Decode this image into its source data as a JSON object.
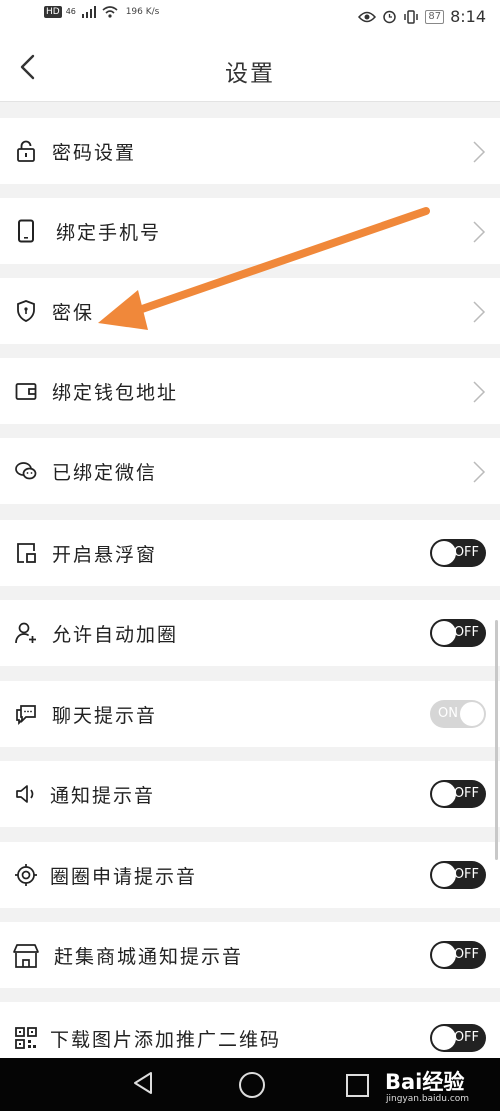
{
  "status_bar": {
    "hd": "HD",
    "network": "46",
    "speed": "196 K/s",
    "battery": "87",
    "time": "8:14"
  },
  "header": {
    "title": "设置"
  },
  "rows": [
    {
      "label": "密码设置",
      "icon": "lock-icon",
      "control": "chevron"
    },
    {
      "label": "绑定手机号",
      "icon": "phone-icon",
      "control": "chevron"
    },
    {
      "label": "密保",
      "icon": "shield-icon",
      "control": "chevron"
    },
    {
      "label": "绑定钱包地址",
      "icon": "wallet-icon",
      "control": "chevron"
    },
    {
      "label": "已绑定微信",
      "icon": "wechat-icon",
      "control": "chevron"
    },
    {
      "label": "开启悬浮窗",
      "icon": "floating-window-icon",
      "control": "toggle",
      "state": "OFF"
    },
    {
      "label": "允许自动加圈",
      "icon": "add-user-icon",
      "control": "toggle",
      "state": "OFF"
    },
    {
      "label": "聊天提示音",
      "icon": "chat-icon",
      "control": "toggle",
      "state": "ON"
    },
    {
      "label": "通知提示音",
      "icon": "speaker-icon",
      "control": "toggle",
      "state": "OFF"
    },
    {
      "label": "圈圈申请提示音",
      "icon": "target-icon",
      "control": "toggle",
      "state": "OFF"
    },
    {
      "label": "赶集商城通知提示音",
      "icon": "store-icon",
      "control": "toggle",
      "state": "OFF"
    },
    {
      "label": "下载图片添加推广二维码",
      "icon": "qr-code-icon",
      "control": "toggle",
      "state": "OFF"
    }
  ],
  "watermark": {
    "brand": "Bai经验",
    "url": "jingyan.baidu.com"
  },
  "colors": {
    "arrow": "#f0883a",
    "toggle_off": "#222222",
    "toggle_on": "#d6d6d6"
  }
}
